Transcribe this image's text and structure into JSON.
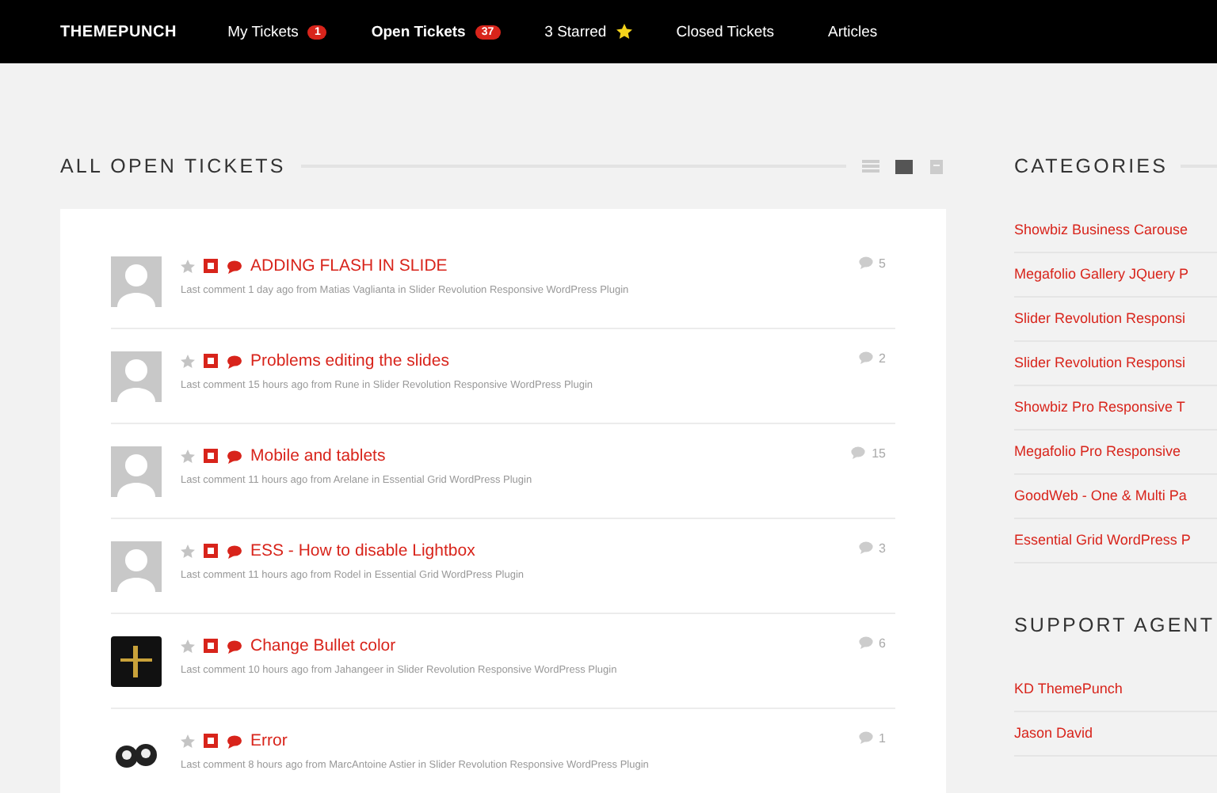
{
  "nav": {
    "brand": "THEMEPUNCH",
    "items": [
      {
        "label": "My Tickets",
        "badge": "1",
        "kind": "badge",
        "selected": false
      },
      {
        "label": "Open Tickets",
        "badge": "37",
        "kind": "badge",
        "selected": true
      },
      {
        "label": "3 Starred",
        "kind": "star",
        "selected": false
      },
      {
        "label": "Closed Tickets",
        "kind": "plain",
        "selected": false
      },
      {
        "label": "Articles",
        "kind": "plain",
        "selected": false
      }
    ]
  },
  "main": {
    "title": "ALL OPEN TICKETS",
    "views": [
      {
        "kind": "list",
        "selected": false
      },
      {
        "kind": "grid",
        "selected": true
      },
      {
        "kind": "doc",
        "selected": false
      }
    ],
    "tickets": [
      {
        "title": "ADDING FLASH IN SLIDE",
        "meta": "Last comment 1 day ago from Matias Vaglianta in Slider Revolution Responsive WordPress Plugin",
        "comments": "5",
        "starred": false,
        "kind": "default"
      },
      {
        "title": "Problems editing the slides",
        "meta": "Last comment 15 hours ago from Rune in Slider Revolution Responsive WordPress Plugin",
        "comments": "2",
        "starred": false,
        "kind": "default"
      },
      {
        "title": "Mobile and tablets",
        "meta": "Last comment 11 hours ago from Arelane in Essential Grid WordPress Plugin",
        "comments": "15",
        "starred": false,
        "kind": "default"
      },
      {
        "title": "ESS - How to disable Lightbox",
        "meta": "Last comment 11 hours ago from Rodel in Essential Grid WordPress Plugin",
        "comments": "3",
        "starred": false,
        "kind": "default"
      },
      {
        "title": "Change Bullet color",
        "meta": "Last comment 10 hours ago from Jahangeer in Slider Revolution Responsive WordPress Plugin",
        "comments": "6",
        "starred": false,
        "kind": "logo"
      },
      {
        "title": "Error",
        "meta": "Last comment 8 hours ago from MarcAntoine Astier in Slider Revolution Responsive WordPress Plugin",
        "comments": "1",
        "starred": false,
        "kind": "photo"
      }
    ]
  },
  "sidebar": {
    "categories_title": "CATEGORIES",
    "categories": [
      "Showbiz Business Carouse",
      "Megafolio Gallery JQuery P",
      "Slider Revolution Responsi",
      "Slider Revolution Responsi",
      "Showbiz Pro Responsive T",
      "Megafolio Pro Responsive",
      "GoodWeb - One & Multi Pa",
      "Essential Grid WordPress P"
    ],
    "agents_title": "SUPPORT AGENT",
    "agents": [
      "KD ThemePunch",
      "Jason David"
    ]
  }
}
